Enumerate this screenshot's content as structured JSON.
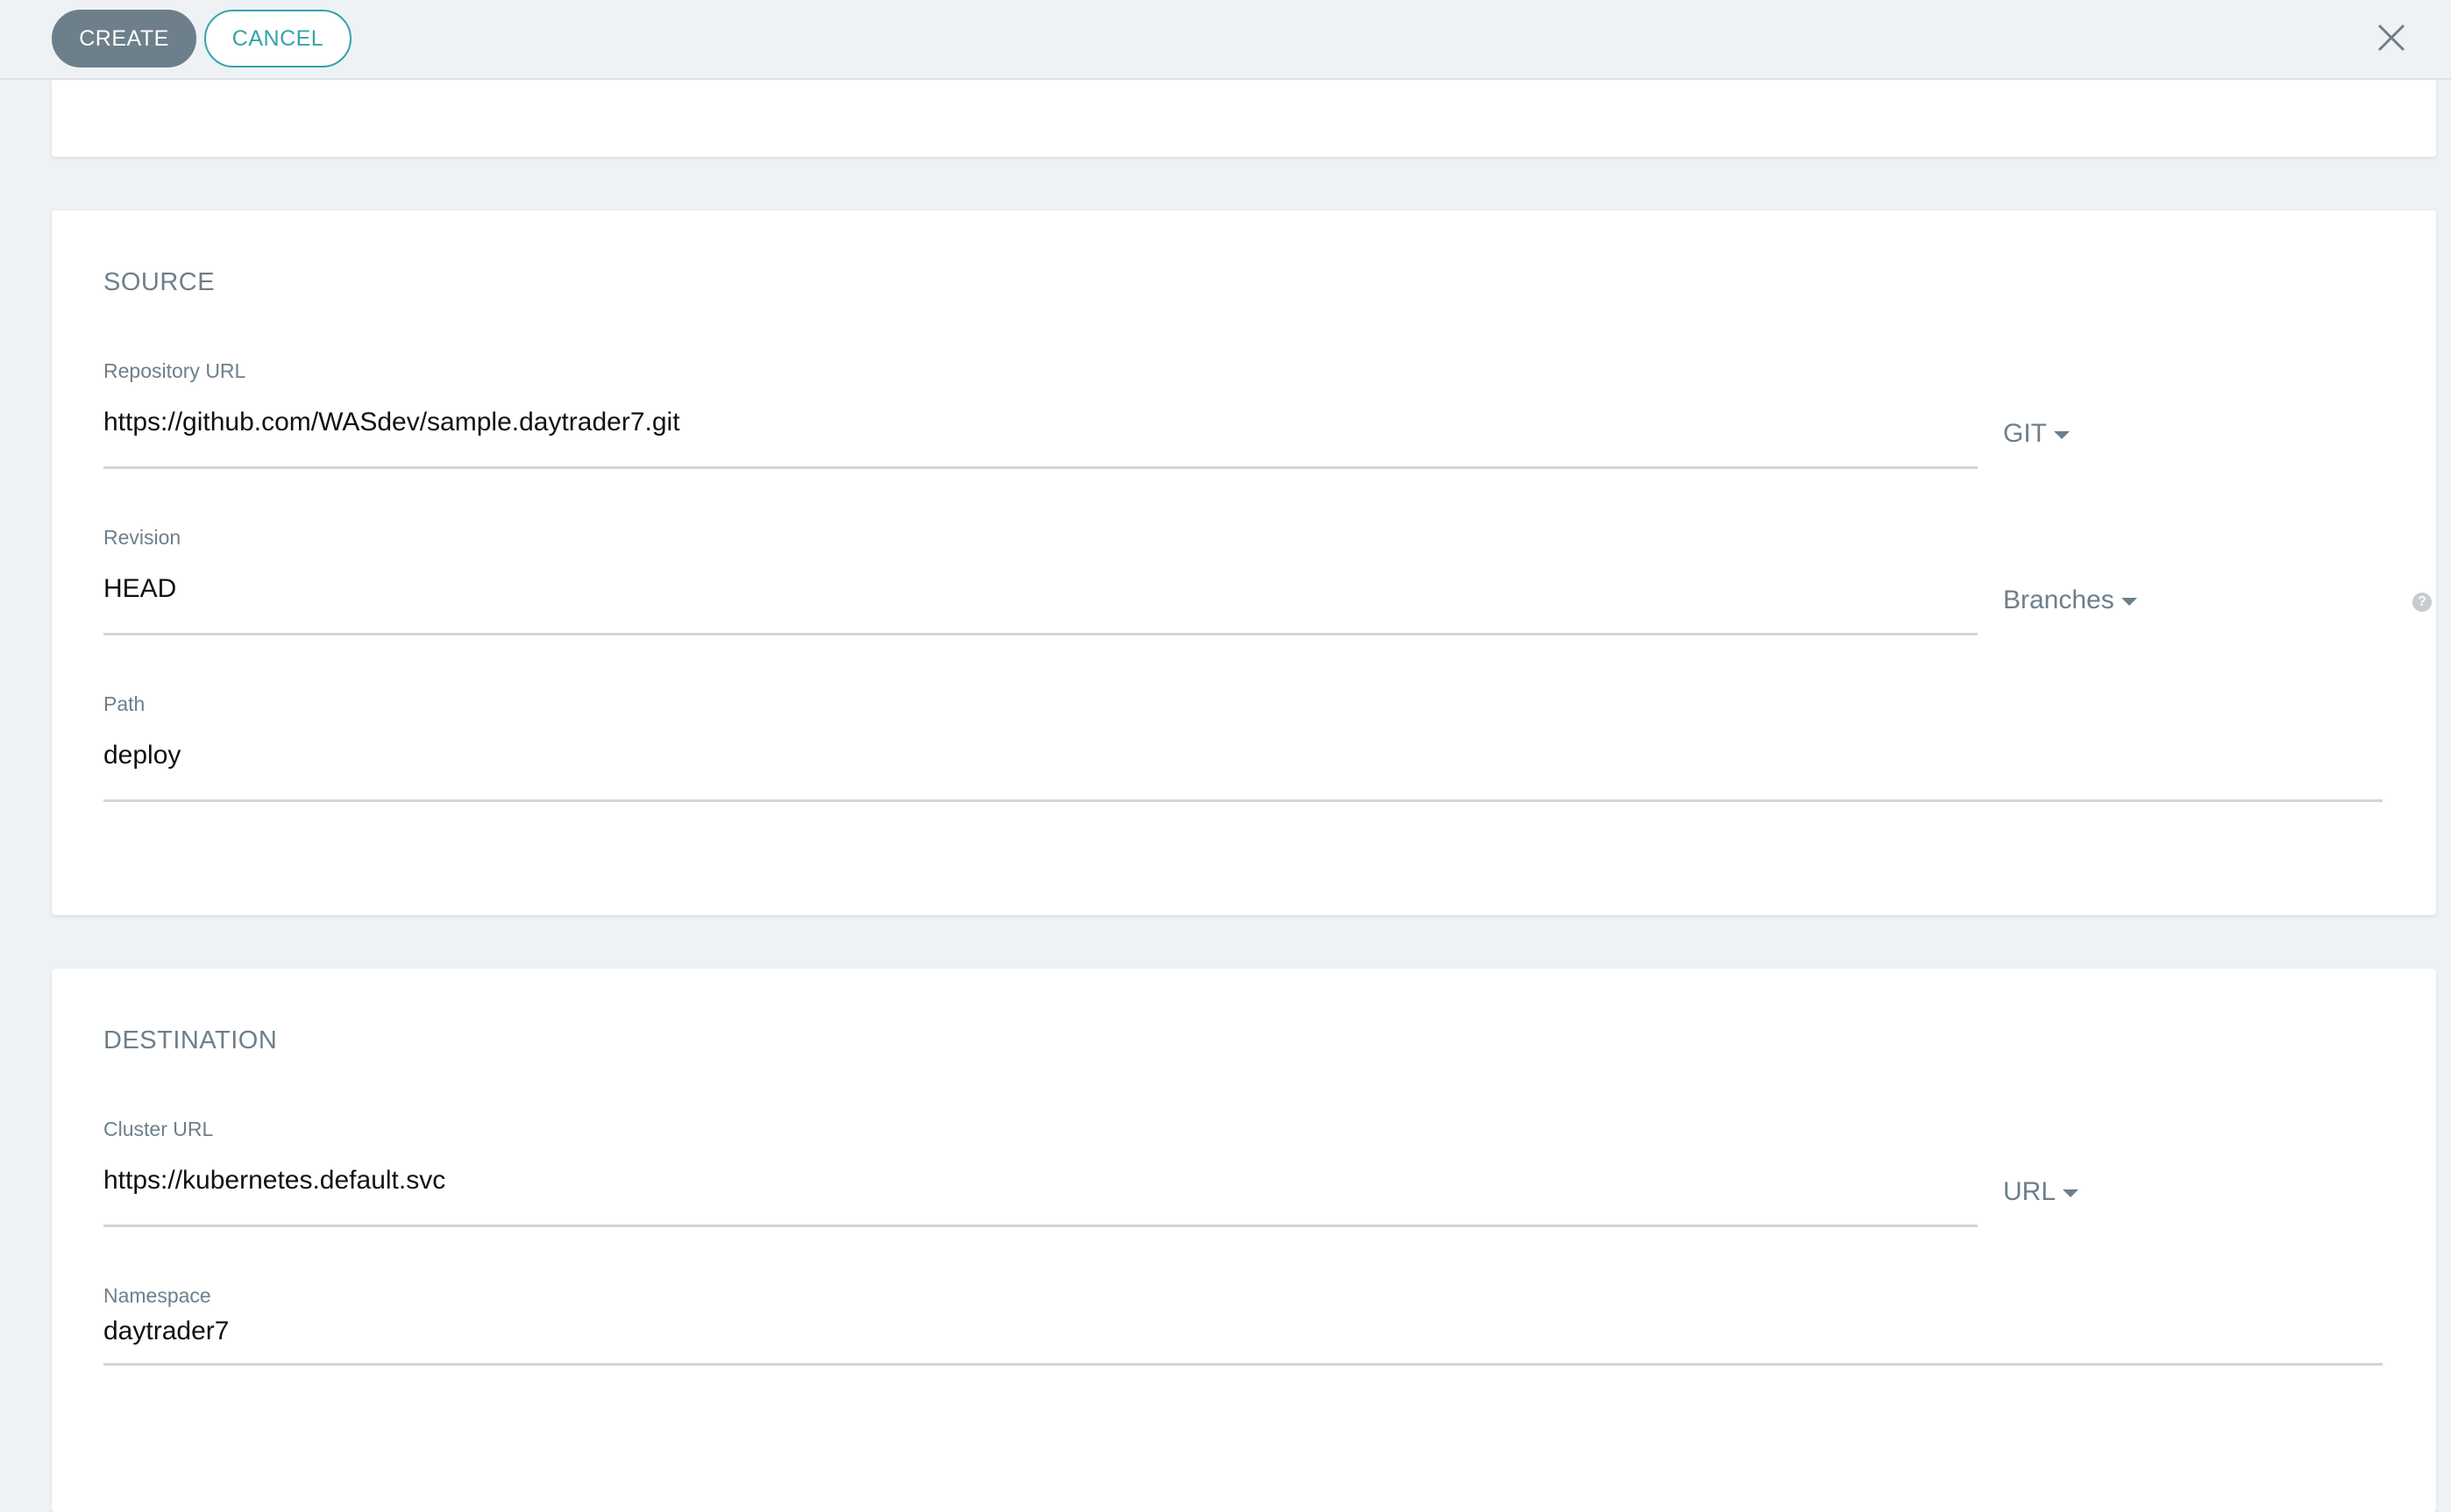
{
  "toolbar": {
    "create_label": "CREATE",
    "cancel_label": "CANCEL",
    "close_icon": "close-icon"
  },
  "source": {
    "title": "SOURCE",
    "repo_url": {
      "label": "Repository URL",
      "value": "https://github.com/WASdev/sample.daytrader7.git",
      "type_selector": "GIT"
    },
    "revision": {
      "label": "Revision",
      "value": "HEAD",
      "type_selector": "Branches",
      "help_icon": "?"
    },
    "path": {
      "label": "Path",
      "value": "deploy"
    }
  },
  "destination": {
    "title": "DESTINATION",
    "cluster_url": {
      "label": "Cluster URL",
      "value": "https://kubernetes.default.svc",
      "type_selector": "URL"
    },
    "namespace": {
      "label": "Namespace",
      "value": "daytrader7"
    }
  },
  "colors": {
    "background": "#eef2f5",
    "create_button": "#6d7f8b",
    "cancel_accent": "#36a3a9",
    "label": "#6d7f8b"
  }
}
